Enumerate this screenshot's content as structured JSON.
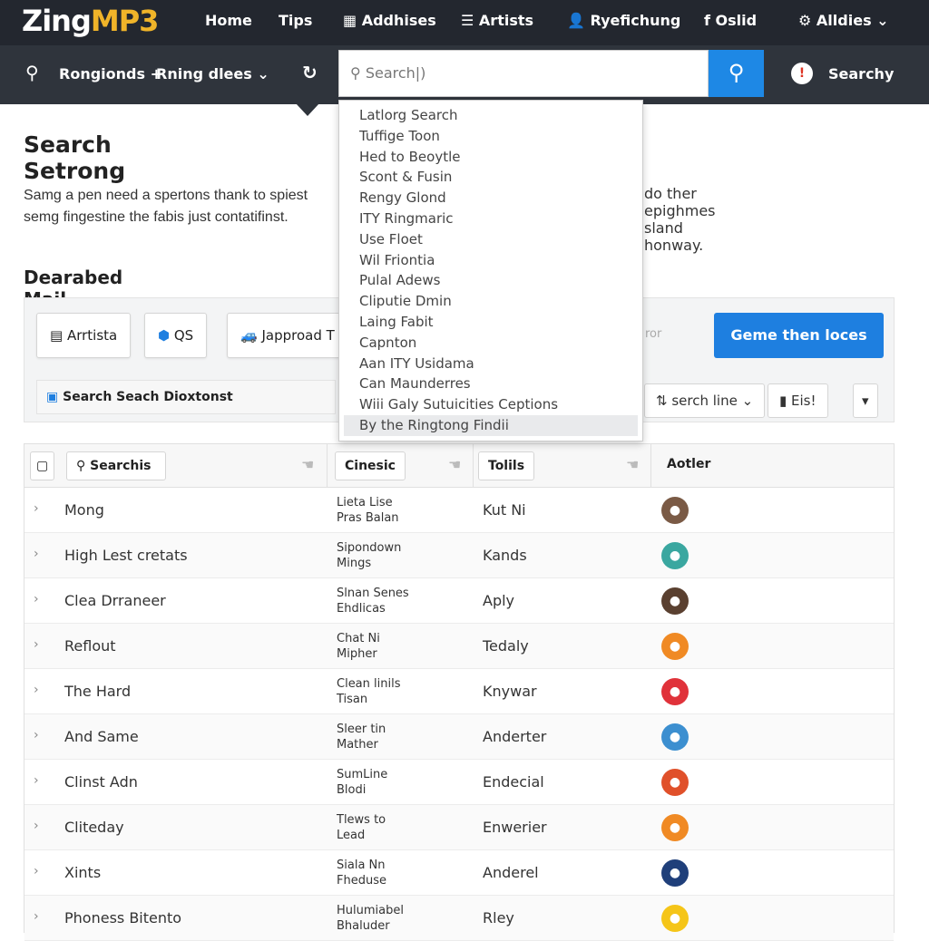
{
  "header": {
    "logo_main": "Zing",
    "logo_accent": "MP3",
    "nav": [
      "Home",
      "Tips",
      "Addhises",
      "Artists",
      "Ryefichung",
      "Oslid",
      "Alldies"
    ]
  },
  "subbar": {
    "filter1": "Rongionds +",
    "filter2": "Rning dlees",
    "search_placeholder": "Search|)",
    "right_label": "Searchy"
  },
  "dropdown": {
    "items": [
      "Latlorg Search",
      "Tuffige Toon",
      "Hed to Beoytle",
      "Scont & Fusin",
      "Rengy Glond",
      "ITY Ringmaric",
      "Use Floet",
      "Wil Friontia",
      "Pulal Adews",
      "Cliputie Dmin",
      "Laing Fabit",
      "Capnton",
      "Aan ITY Usidama",
      "Can Maunderres",
      "Wiii Galy Sutuicities Ceptions",
      "By the Ringtong Findii"
    ],
    "selected_index": 15
  },
  "main": {
    "title": "Search Setrong",
    "paragraph_line1": "Samg a pen need a spertons thank to spiest",
    "paragraph_line2": "semg fingestine the fabis just contatifinst.",
    "paragraph_right": "do ther epighmes sland honway.",
    "section_title": "Dearabed Mail"
  },
  "panel": {
    "chips": [
      "Arrtista",
      "QS",
      "Japproad T"
    ],
    "hint": "ror",
    "primary_button": "Geme then loces",
    "search_label": "Search Seach Dioxtonst",
    "sort_label": "serch line",
    "action_label": "Eis!"
  },
  "table": {
    "headers": [
      "Searchis",
      "Cinesic",
      "Tolils",
      "Aotler"
    ],
    "rows": [
      {
        "name": "Mong",
        "detail1": "Lieta Lise",
        "detail2": "Pras Balan",
        "col3": "Kut Ni",
        "avatar_color": "#7a5a45"
      },
      {
        "name": "High Lest cretats",
        "detail1": "Sipondown",
        "detail2": "Mings",
        "col3": "Kands",
        "avatar_color": "#3aa7a0"
      },
      {
        "name": "Clea Drraneer",
        "detail1": "Slnan Senes",
        "detail2": "Ehdlicas",
        "col3": "Aply",
        "avatar_color": "#5a4030"
      },
      {
        "name": "Reflout",
        "detail1": "Chat Ni",
        "detail2": "Mipher",
        "col3": "Tedaly",
        "avatar_color": "#f08a24"
      },
      {
        "name": "The Hard",
        "detail1": "Clean linils",
        "detail2": "Tisan",
        "col3": "Knywar",
        "avatar_color": "#e0323a"
      },
      {
        "name": "And Same",
        "detail1": "Sleer tin",
        "detail2": "Mather",
        "col3": "Anderter",
        "avatar_color": "#3c8fd0"
      },
      {
        "name": "Clinst Adn",
        "detail1": "SumLine",
        "detail2": "Blodi",
        "col3": "Endecial",
        "avatar_color": "#e0502a"
      },
      {
        "name": "Cliteday",
        "detail1": "Tlews to",
        "detail2": "Lead",
        "col3": "Enwerier",
        "avatar_color": "#f08a24"
      },
      {
        "name": "Xints",
        "detail1": "Siala Nn",
        "detail2": "Fheduse",
        "col3": "Anderel",
        "avatar_color": "#1f3f7a"
      },
      {
        "name": "Phoness Bitento",
        "detail1": "Hulumiabel",
        "detail2": "Bhaluder",
        "col3": "Rley",
        "avatar_color": "#f5c518"
      }
    ]
  }
}
